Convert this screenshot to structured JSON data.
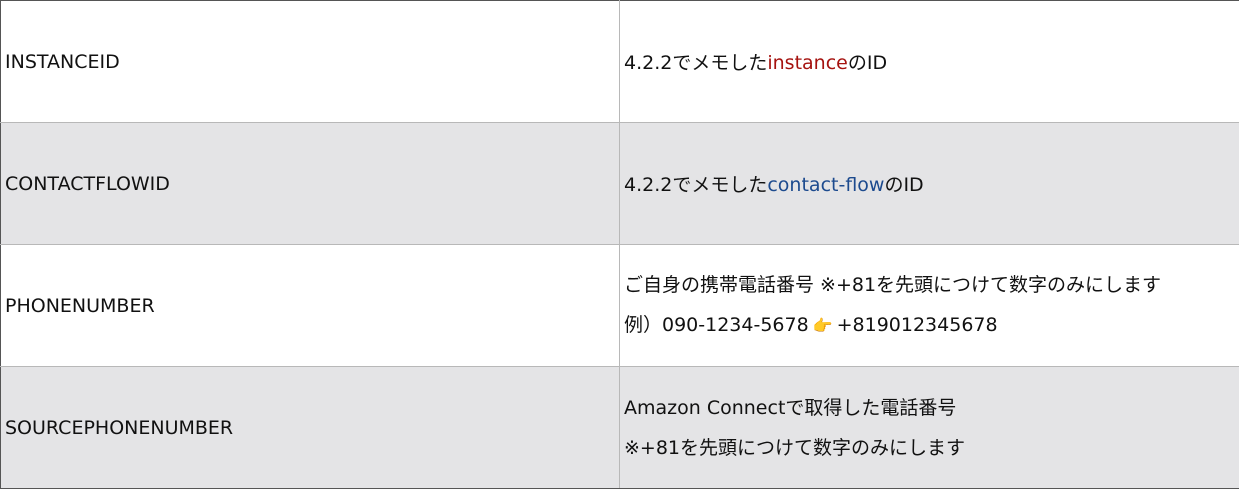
{
  "rows": [
    {
      "key": "INSTANCEID",
      "value": {
        "prefix": "4.2.2でメモした",
        "highlight": "instance",
        "suffix": "のID",
        "highlight_color": "#a5120f"
      }
    },
    {
      "key": "CONTACTFLOWID",
      "value": {
        "prefix": "4.2.2でメモした",
        "highlight": "contact-flow",
        "suffix": "のID",
        "highlight_color": "#1c4a8e"
      }
    },
    {
      "key": "PHONENUMBER",
      "value": {
        "line1": "ご自身の携帯電話番号 ※+81を先頭につけて数字のみにします",
        "line2_prefix": "例）090-1234-5678",
        "line2_icon": "👉",
        "line2_suffix": "+819012345678"
      }
    },
    {
      "key": "SOURCEPHONENUMBER",
      "value": {
        "line1": "Amazon Connectで取得した電話番号",
        "line2": "※+81を先頭につけて数字のみにします"
      }
    }
  ],
  "colors": {
    "row_alt_background": "#e4e4e6",
    "border": "#b8b8b8"
  }
}
